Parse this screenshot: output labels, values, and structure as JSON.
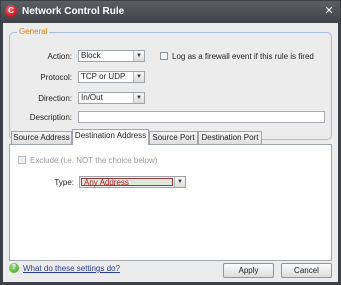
{
  "window": {
    "title": "Network Control Rule",
    "logo_letter": "C",
    "close_glyph": "✕"
  },
  "general": {
    "legend": "General",
    "action": {
      "label": "Action:",
      "value": "Block"
    },
    "log_checkbox": {
      "label": "Log as a firewall event if this rule is fired",
      "checked": false
    },
    "protocol": {
      "label": "Protocol:",
      "value": "TCP or UDP"
    },
    "direction": {
      "label": "Direction:",
      "value": "In/Out"
    },
    "description": {
      "label": "Description:",
      "value": ""
    }
  },
  "tabs": [
    {
      "label": "Source Address",
      "active": false
    },
    {
      "label": "Destination Address",
      "active": true
    },
    {
      "label": "Source Port",
      "active": false
    },
    {
      "label": "Destination Port",
      "active": false
    }
  ],
  "panel": {
    "exclude_label": "Exclude (i.e. NOT the choice below)",
    "exclude_enabled": false,
    "type_label": "Type:",
    "type_value": "Any Address"
  },
  "footer": {
    "help_glyph": "?",
    "help_link": "What do these settings do?",
    "apply_label": "Apply",
    "cancel_label": "Cancel"
  },
  "colors": {
    "accent_legend": "#e07f12",
    "link": "#2a3d9a",
    "error_text": "#b71c1c",
    "logo": "#c8171d",
    "help_icon": "#3c9a26"
  },
  "icons": {
    "logo": "app-logo-icon",
    "close": "close-icon",
    "dropdown": "chevron-down-icon",
    "help": "help-icon"
  }
}
